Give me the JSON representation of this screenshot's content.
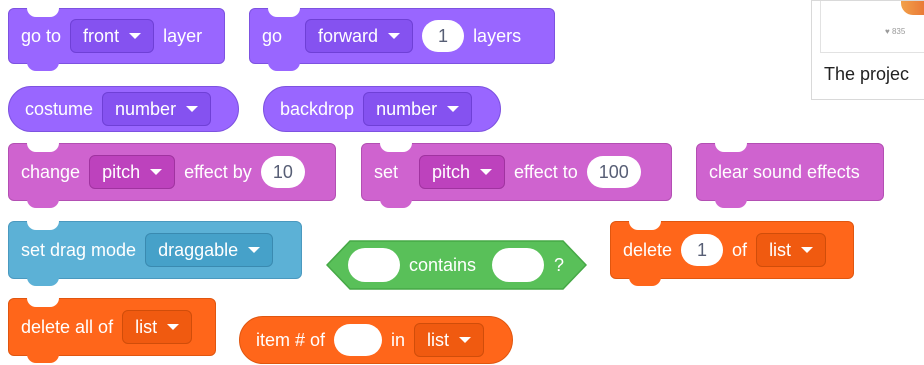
{
  "colors": {
    "looks": "#9966ff",
    "sound": "#cf63cf",
    "sensing": "#5cb1d6",
    "list": "#ff661a",
    "operators": "#59c059"
  },
  "row1": {
    "goto": {
      "label1": "go to",
      "menu": "front",
      "label2": "layer"
    },
    "go": {
      "label1": "go",
      "menu": "forward",
      "value": "1",
      "label2": "layers"
    }
  },
  "row2": {
    "costume": {
      "label": "costume",
      "menu": "number"
    },
    "backdrop": {
      "label": "backdrop",
      "menu": "number"
    }
  },
  "row3": {
    "change": {
      "label1": "change",
      "menu": "pitch",
      "label2": "effect by",
      "value": "10"
    },
    "set": {
      "label1": "set",
      "menu": "pitch",
      "label2": "effect to",
      "value": "100"
    },
    "clear": {
      "label": "clear sound effects"
    }
  },
  "row4": {
    "drag": {
      "label": "set drag mode",
      "menu": "draggable"
    },
    "contains": {
      "label": "contains",
      "q": "?"
    },
    "delete": {
      "label1": "delete",
      "value": "1",
      "label2": "of",
      "menu": "list"
    }
  },
  "row5": {
    "deleteall": {
      "label": "delete all of",
      "menu": "list"
    },
    "itemnum": {
      "label1": "item # of",
      "label2": "in",
      "menu": "list"
    }
  },
  "panel": {
    "likes": "835",
    "caption": "The projec"
  }
}
